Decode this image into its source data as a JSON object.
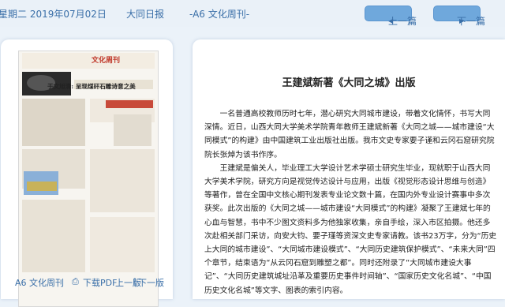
{
  "header": {
    "date": "星期二 2019年07月02日",
    "paper_name": "大同日报",
    "section": "-A6 文化周刊-",
    "prev_button": "上一篇",
    "next_button": "下一篇"
  },
  "thumbnail": {
    "masthead": "文化周刊",
    "headline": "于文旭清: 呈现煤矸石雕诗意之美",
    "section_label": "A6 文化周刊",
    "pdf_link": "下载PDF",
    "prev_page": "上一版",
    "separator": "|",
    "next_page": "下一版"
  },
  "article": {
    "title": "王建斌新著《大同之城》出版",
    "paragraphs": [
      "一名普通高校教师历时七年，潜心研究大同城市建设，带着文化情怀，书写大同深情。近日，山西大同大学美术学院青年教师王建斌新著《大同之城——城市建设“大同模式”的构建》由中国建筑工业出版社出版。我市文史专家要子谨和云冈石窟研究院院长张焯为该书作序。",
      "王建斌是偏关人，毕业理工大学设计艺术学硕士研究生毕业，现就职于山西大同大学美术学院，研究方向是视觉传达设计与应用，出版《视觉形态设计思维与创造》等著作，曾在全国中文核心期刊发表专业论文数十篇，在国内外专业设计赛事中多次获奖。此次出版的《大同之城——城市建设“大同模式”的构建》凝聚了王建斌七年的心血与智慧，书中不少图文资料多为他独家收集，亲自手绘，深入市区拍摄。他还多次赴相关部门采访，向安大钧、要子瑾等资深文史专家请教。该书23万字，分为“历史上大同的城市建设”、“大同城市建设模式”、“大同历史建筑保护模式”、“未来大同”四个章节，结束语为“从云冈石窟到雕塑之都”。同时还附录了“大同城市建设大事记”、“大同历史建筑城址沿革及重要历史事件时间轴”、“国家历史文化名城”、“中国历史文化名城”等文字、图表的索引内容。"
    ]
  },
  "colors": {
    "accent": "#6fa8dc",
    "text_blue": "#3a6fa8",
    "background": "#ebf2f9"
  }
}
